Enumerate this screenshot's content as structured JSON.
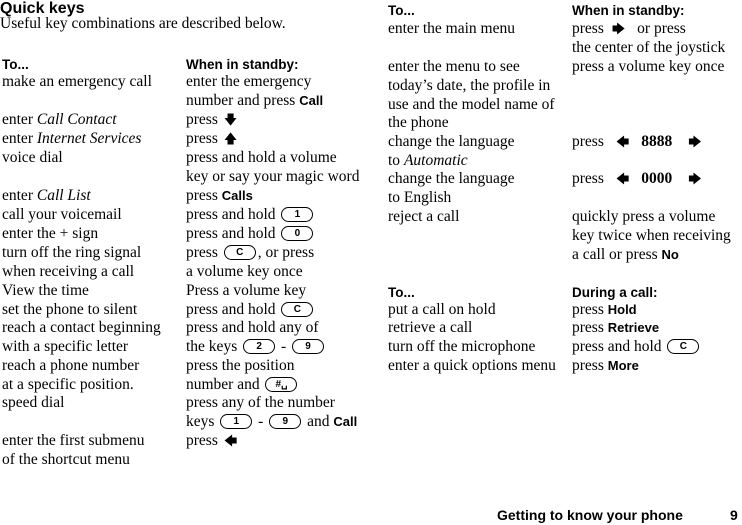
{
  "title": "Quick keys",
  "subtitle": "Useful key combinations are described below.",
  "left_table": {
    "header_col1": "To...",
    "header_col2": "When in standby:",
    "rows": [
      {
        "action": [
          "make an emergency call"
        ],
        "how": [
          "enter the emergency",
          "number and press {Call}"
        ]
      },
      {
        "action": [
          "enter {i:Call Contact}"
        ],
        "how": [
          "press {down-arrow}"
        ]
      },
      {
        "action": [
          "enter {i:Internet Services}"
        ],
        "how": [
          "press {up-arrow}"
        ]
      },
      {
        "action": [
          "voice dial"
        ],
        "how": [
          "press and hold a volume",
          "key or say your magic word"
        ]
      },
      {
        "action": [
          "enter {i:Call List}"
        ],
        "how": [
          "press {Calls}"
        ]
      },
      {
        "action": [
          "call your voicemail"
        ],
        "how": [
          "press and hold [1]"
        ]
      },
      {
        "action": [
          "enter the + sign"
        ],
        "how": [
          "press and hold [0]"
        ]
      },
      {
        "action": [
          "turn off the ring signal",
          "when receiving a call"
        ],
        "how": [
          "press [C], or press",
          "a volume key once"
        ]
      },
      {
        "action": [
          "View the time"
        ],
        "how": [
          "Press a volume key"
        ]
      },
      {
        "action": [
          "set the phone to silent"
        ],
        "how": [
          "press and hold [C]"
        ]
      },
      {
        "action": [
          "reach a contact beginning",
          "with a specific letter"
        ],
        "how": [
          "press and hold any of",
          "the keys [2] - [9]"
        ]
      },
      {
        "action": [
          "reach a phone number",
          "at a specific position."
        ],
        "how": [
          "press the position",
          "number and [#]"
        ]
      },
      {
        "action": [
          "speed dial"
        ],
        "how": [
          "press any of the number",
          "keys [1] - [9] and {Call}"
        ]
      },
      {
        "action": [
          "enter the first submenu",
          "of the shortcut menu"
        ],
        "how": [
          "press {left-arrow}"
        ]
      }
    ]
  },
  "right_table_1": {
    "header_col1": "To...",
    "header_col2": "When in standby:",
    "rows": [
      {
        "action": [
          "enter the main menu"
        ],
        "how": [
          "press {right-arrow} or press",
          "the center of the joystick"
        ]
      },
      {
        "action": [
          "enter the menu to see",
          "today’s date, the profile in",
          "use and the model name of",
          "the phone"
        ],
        "how": [
          "press a volume key once"
        ]
      },
      {
        "action": [
          "change the language",
          "to {i:Automatic}"
        ],
        "how": [
          "press {left-arrow} 8888 {right-arrow}"
        ]
      },
      {
        "action": [
          "change the language",
          "to English"
        ],
        "how": [
          "press {left-arrow} 0000 {right-arrow}"
        ]
      },
      {
        "action": [
          "reject a call"
        ],
        "how": [
          "quickly press a volume",
          "key twice when receiving",
          "a call or press {No}"
        ]
      }
    ]
  },
  "right_table_2": {
    "header_col1": "To...",
    "header_col2": "During a call:",
    "rows": [
      {
        "action": [
          "put a call on hold"
        ],
        "how": [
          "press {Hold}"
        ]
      },
      {
        "action": [
          "retrieve a call"
        ],
        "how": [
          "press {Retrieve}"
        ]
      },
      {
        "action": [
          "turn off the microphone"
        ],
        "how": [
          "press and hold [C]"
        ]
      },
      {
        "action": [
          "enter a quick options menu"
        ],
        "how": [
          "press {More}"
        ]
      }
    ]
  },
  "keys": {
    "one": "1",
    "zero": "0",
    "c": "C",
    "two": "2",
    "nine": "9",
    "hash": "#␣"
  },
  "words": {
    "call": "Call",
    "calls": "Calls",
    "no": "No",
    "hold": "Hold",
    "retrieve": "Retrieve",
    "more": "More",
    "code_auto": "8888",
    "code_en": "0000"
  },
  "footer": {
    "section": "Getting to know your phone",
    "page": "9"
  },
  "texts": {
    "l1a": "make an emergency call",
    "l1b1": "enter the emergency",
    "l1b2": "number and press ",
    "l2a_pre": "enter ",
    "l2a_it": "Call Contact",
    "press": "press",
    "l3a_it": "Internet Services",
    "l4a": "voice dial",
    "l4b1": "press and hold a volume",
    "l4b2": "key or say your magic word",
    "l5a_it": "Call List",
    "press_sp": "press ",
    "l6a": "call your voicemail",
    "pah": "press and hold ",
    "l7a": "enter the + sign",
    "l8a1": "turn off the ring signal",
    "l8a2": "when receiving a call",
    "l8b1_post": ", or press",
    "l8b2": "a volume key once",
    "l9a": "View the time",
    "l9b": "Press a volume key",
    "l10a": "set the phone to silent",
    "l11a1": "reach a contact beginning",
    "l11a2": "with a specific letter",
    "l11b1": "press and hold any of",
    "l11b2": "the keys ",
    "dash": " - ",
    "l12a1": "reach a phone number",
    "l12a2": "at a specific position.",
    "l12b1": "press the position",
    "l12b2": "number and ",
    "l13a": "speed dial",
    "l13b1": "press any of the number",
    "l13b2": "keys ",
    "and_sp": " and ",
    "l14a1": "enter the first submenu",
    "l14a2": "of the shortcut menu",
    "r1a": "enter the main menu",
    "r1b1_post": " or press",
    "r1b2": "the center of the joystick",
    "r2a1": "enter the menu to see",
    "r2a2": "today’s date, the profile in",
    "r2a3": "use and the model name of",
    "r2a4": "the phone",
    "r2b": "press a volume key once",
    "r3a1": "change the language",
    "r3a2_pre": "to ",
    "r3a2_it": "Automatic",
    "r4a2": "to English",
    "r5a": "reject a call",
    "r5b1": "quickly press a volume",
    "r5b2": "key twice when receiving",
    "r5b3": "a call or press ",
    "c1a": "put a call on hold",
    "c2a": "retrieve a call",
    "c3a": "turn off the microphone",
    "c4a": "enter a quick options menu"
  }
}
